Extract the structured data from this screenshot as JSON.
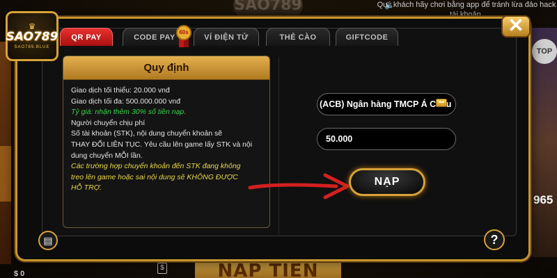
{
  "background": {
    "top_logo": "SAO789",
    "notice": "Quý khách hãy chơi bằng app để tránh lừa đảo hack tài khoản.",
    "bottom_banner": "NẠP TIỀN",
    "right_top": "TOP",
    "right_number": "965",
    "bottom_left": "$ 0"
  },
  "logo": {
    "brand": "SAO789",
    "sub": "SAO789.BLUE"
  },
  "close": {
    "label": "✕",
    "icon": "close-icon"
  },
  "tabs": [
    {
      "label": "QR PAY",
      "active": true
    },
    {
      "label": "CODE PAY",
      "active": false
    },
    {
      "label": "VÍ ĐIỆN TỬ",
      "active": false
    },
    {
      "label": "THẺ CÀO",
      "active": false
    },
    {
      "label": "GIFTCODE",
      "active": false
    }
  ],
  "badge": {
    "label": "60s"
  },
  "rules": {
    "title": "Quy định",
    "lines": [
      {
        "text": "Giao dịch tối thiểu: 20.000 vnđ",
        "style": "line"
      },
      {
        "text": "Giao dịch tối đa: 500.000.000 vnđ",
        "style": "line"
      },
      {
        "text": "Tỷ giá: nhận thêm 30% số tiền nạp.",
        "style": "green"
      },
      {
        "text": "Người chuyển chịu phí",
        "style": "line"
      },
      {
        "text": "Số tài khoản (STK), nội dung chuyển khoản sẽ",
        "style": "line"
      },
      {
        "text": "THAY ĐỔI LIÊN TỤC. Yêu cầu lên game lấy STK và nội",
        "style": "line"
      },
      {
        "text": "dung chuyển MỖI lần.",
        "style": "line"
      },
      {
        "text": "Các trường hợp chuyển khoản đến STK đang không",
        "style": "yellow"
      },
      {
        "text": "treo lên game hoặc sai nội dung sẽ KHÔNG ĐƯỢC",
        "style": "yellow"
      },
      {
        "text": "HỖ TRỢ.",
        "style": "yellow"
      }
    ]
  },
  "form": {
    "bank": "(ACB) Ngân hàng TMCP Á Châu",
    "amount": "50.000",
    "submit": "NẠP"
  },
  "buttons": {
    "help": "?",
    "doc_icon": "document-icon"
  },
  "colors": {
    "accent_gold": "#c8962e",
    "active_tab": "#d82020",
    "green_text": "#38d24a",
    "yellow_text": "#e8d84a",
    "arrow": "#d42020"
  }
}
